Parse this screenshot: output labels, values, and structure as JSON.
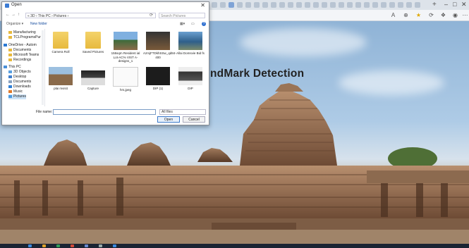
{
  "dialog": {
    "title": "Open",
    "breadcrumb": "« 3D › This PC › Pictures ›",
    "search_placeholder": "Search Pictures",
    "organize_label": "Organize ▾",
    "new_folder_label": "New folder",
    "nav_items": [
      {
        "label": "Manufacturing",
        "kind": "folder"
      },
      {
        "label": "TCLProgramsPur",
        "kind": "folder"
      },
      {
        "label": "OneDrive - Autom",
        "kind": "cloud"
      },
      {
        "label": "Documents",
        "kind": "folder"
      },
      {
        "label": "Microsoft Teams",
        "kind": "folder"
      },
      {
        "label": "Recordings",
        "kind": "folder"
      },
      {
        "label": "This PC",
        "kind": "pc"
      },
      {
        "label": "3D Objects",
        "kind": "folder3d"
      },
      {
        "label": "Desktop",
        "kind": "desktop"
      },
      {
        "label": "Documents",
        "kind": "docs"
      },
      {
        "label": "Downloads",
        "kind": "down"
      },
      {
        "label": "Music",
        "kind": "music"
      },
      {
        "label": "Pictures",
        "kind": "pics"
      }
    ],
    "files": [
      {
        "name": "Camera Roll",
        "kind": "folder"
      },
      {
        "name": "Saved Pictures",
        "kind": "folder"
      },
      {
        "name": "155sqm Resident ial Lot-AC% VIST A-designs_1",
        "kind": "house"
      },
      {
        "name": "AzmjFTDkhSSw_qd84-400",
        "kind": "dark"
      },
      {
        "name": "Allai Domsvie Bid fs",
        "kind": "water"
      },
      {
        "name": "plai mvisit",
        "kind": "temple"
      },
      {
        "name": "Capture",
        "kind": "screen"
      },
      {
        "name": "hrs.jpeg",
        "kind": "blank"
      },
      {
        "name": "DIP (1)",
        "kind": "dark2"
      },
      {
        "name": "DIP",
        "kind": "screen2"
      }
    ],
    "filename_label": "File name:",
    "filename_value": "",
    "filter_value": "All files",
    "open_label": "Open",
    "cancel_label": "Cancel"
  },
  "page": {
    "heading": "ndMark Detection"
  },
  "colors": {
    "accent": "#3a78c9",
    "folder": "#e7b93d"
  }
}
